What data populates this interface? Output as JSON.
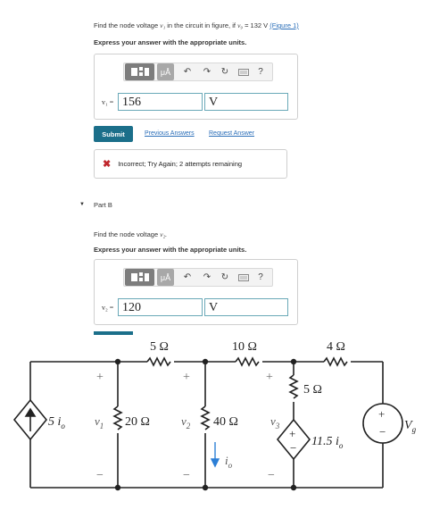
{
  "partA": {
    "question_prefix": "Find the node voltage",
    "var": "v₁",
    "question_mid": "in the circuit in figure, if",
    "given_var": "v₉",
    "given_value": "= 132 V",
    "figure_link": "(Figure 1)",
    "instruction": "Express your answer with the appropriate units.",
    "answer_label": "v₁ =",
    "answer_value": "156",
    "unit_value": "V",
    "submit_label": "Submit",
    "previous_answers": "Previous Answers",
    "request_answer": "Request Answer",
    "feedback": "Incorrect; Try Again; 2 attempts remaining"
  },
  "toolbar": {
    "unit_btn": "μÅ",
    "help": "?"
  },
  "partB": {
    "title": "Part B",
    "question": "Find the node voltage",
    "var": "v₂.",
    "instruction": "Express your answer with the appropriate units.",
    "answer_label": "v₂ =",
    "answer_value": "120",
    "unit_value": "V"
  },
  "circuit": {
    "r_top1": "5 Ω",
    "r_top2": "10 Ω",
    "r_top3": "4 Ω",
    "r_right": "5 Ω",
    "r_mid1": "20 Ω",
    "r_mid2": "40 Ω",
    "src_left": "5 i",
    "src_left_sub": "o",
    "src_dep": "11.5 i",
    "src_dep_sub": "o",
    "v1": "v",
    "v1_sub": "1",
    "v2": "v",
    "v2_sub": "2",
    "v3": "v",
    "v3_sub": "3",
    "vg": "V",
    "vg_sub": "g",
    "io": "i",
    "io_sub": "o",
    "plus": "+",
    "minus": "−"
  }
}
